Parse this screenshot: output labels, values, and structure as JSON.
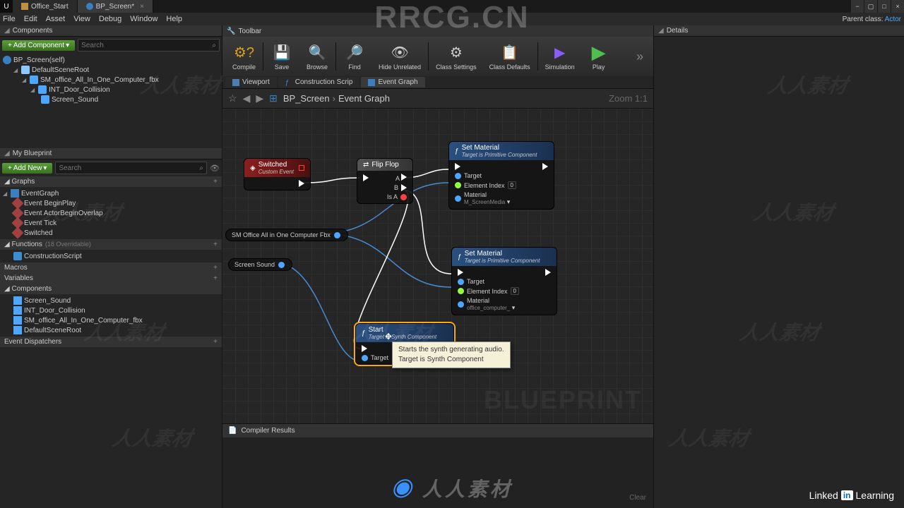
{
  "titlebar": {
    "tabs": [
      {
        "label": "Office_Start",
        "icon": "level-icon"
      },
      {
        "label": "BP_Screen*",
        "icon": "blueprint-icon"
      }
    ]
  },
  "menubar": {
    "items": [
      "File",
      "Edit",
      "Asset",
      "View",
      "Debug",
      "Window",
      "Help"
    ],
    "parent_class_label": "Parent class:",
    "parent_class_value": "Actor"
  },
  "components_panel": {
    "title": "Components",
    "add_label": "Add Component",
    "search_placeholder": "Search",
    "root": "BP_Screen(self)",
    "items": [
      {
        "label": "DefaultSceneRoot",
        "indent": 1,
        "icon": "icon-comp"
      },
      {
        "label": "SM_office_All_In_One_Computer_fbx",
        "indent": 2,
        "icon": "icon-mesh"
      },
      {
        "label": "INT_Door_Collision",
        "indent": 3,
        "icon": "icon-coll"
      },
      {
        "label": "Screen_Sound",
        "indent": 3,
        "icon": "icon-sound"
      }
    ]
  },
  "myblueprint": {
    "title": "My Blueprint",
    "add_label": "Add New",
    "search_placeholder": "Search",
    "sections": {
      "graphs": {
        "label": "Graphs",
        "root": "EventGraph",
        "events": [
          "Event BeginPlay",
          "Event ActorBeginOverlap",
          "Event Tick",
          "Switched"
        ]
      },
      "functions": {
        "label": "Functions",
        "sub": "(18 Overridable)",
        "items": [
          "ConstructionScript"
        ]
      },
      "macros": {
        "label": "Macros"
      },
      "variables": {
        "label": "Variables"
      },
      "components": {
        "label": "Components",
        "items": [
          "Screen_Sound",
          "INT_Door_Collision",
          "SM_office_All_In_One_Computer_fbx",
          "DefaultSceneRoot"
        ]
      },
      "dispatchers": {
        "label": "Event Dispatchers"
      }
    }
  },
  "toolbar": {
    "title": "Toolbar",
    "buttons": [
      {
        "label": "Compile",
        "icon": "⚙?",
        "color": "#d6a020"
      },
      {
        "label": "Save",
        "icon": "💾",
        "color": "#3a7fbf"
      },
      {
        "label": "Browse",
        "icon": "🔍",
        "color": "#8a5cff"
      },
      {
        "label": "Find",
        "icon": "🔎",
        "color": "#3a7fbf"
      },
      {
        "label": "Hide Unrelated",
        "icon": "👁",
        "color": "#888"
      },
      {
        "label": "Class Settings",
        "icon": "⚙",
        "color": "#888"
      },
      {
        "label": "Class Defaults",
        "icon": "📋",
        "color": "#888"
      },
      {
        "label": "Simulation",
        "icon": "▶",
        "color": "#8a5cff"
      },
      {
        "label": "Play",
        "icon": "▶",
        "color": "#4fbf4f"
      }
    ]
  },
  "inner_tabs": [
    {
      "label": "Viewport"
    },
    {
      "label": "Construction Scrip"
    },
    {
      "label": "Event Graph",
      "active": true
    }
  ],
  "breadcrumb": {
    "root": "BP_Screen",
    "current": "Event Graph",
    "zoom": "Zoom 1:1"
  },
  "graph": {
    "watermark": "BLUEPRINT",
    "nodes": {
      "switched": {
        "title": "Switched",
        "sub": "Custom Event"
      },
      "flipflop": {
        "title": "Flip Flop",
        "pinA": "A",
        "pinB": "B",
        "isA": "Is A"
      },
      "setmat1": {
        "title": "Set Material",
        "sub": "Target is Primitive Component",
        "target": "Target",
        "elemIdx": "Element Index",
        "elemVal": "0",
        "material": "Material",
        "matVal": "M_ScreenMedia"
      },
      "setmat2": {
        "title": "Set Material",
        "sub": "Target is Primitive Component",
        "target": "Target",
        "elemIdx": "Element Index",
        "elemVal": "0",
        "material": "Material",
        "matVal": "office_computer_"
      },
      "start": {
        "title": "Start",
        "sub": "Target is Synth Component",
        "target": "Target"
      },
      "var1": "SM Office All in One Computer Fbx",
      "var2": "Screen Sound"
    },
    "tooltip": {
      "line1": "Starts the synth generating audio.",
      "line2": "Target is Synth Component"
    }
  },
  "compiler": {
    "title": "Compiler Results",
    "clear": "Clear"
  },
  "details": {
    "title": "Details"
  },
  "watermarks": {
    "top": "RRCG.CN",
    "bottom": "人人素材",
    "scattered": "人人素材"
  },
  "linkedin": {
    "text": "Linked",
    "box": "in",
    "suffix": "Learning"
  }
}
